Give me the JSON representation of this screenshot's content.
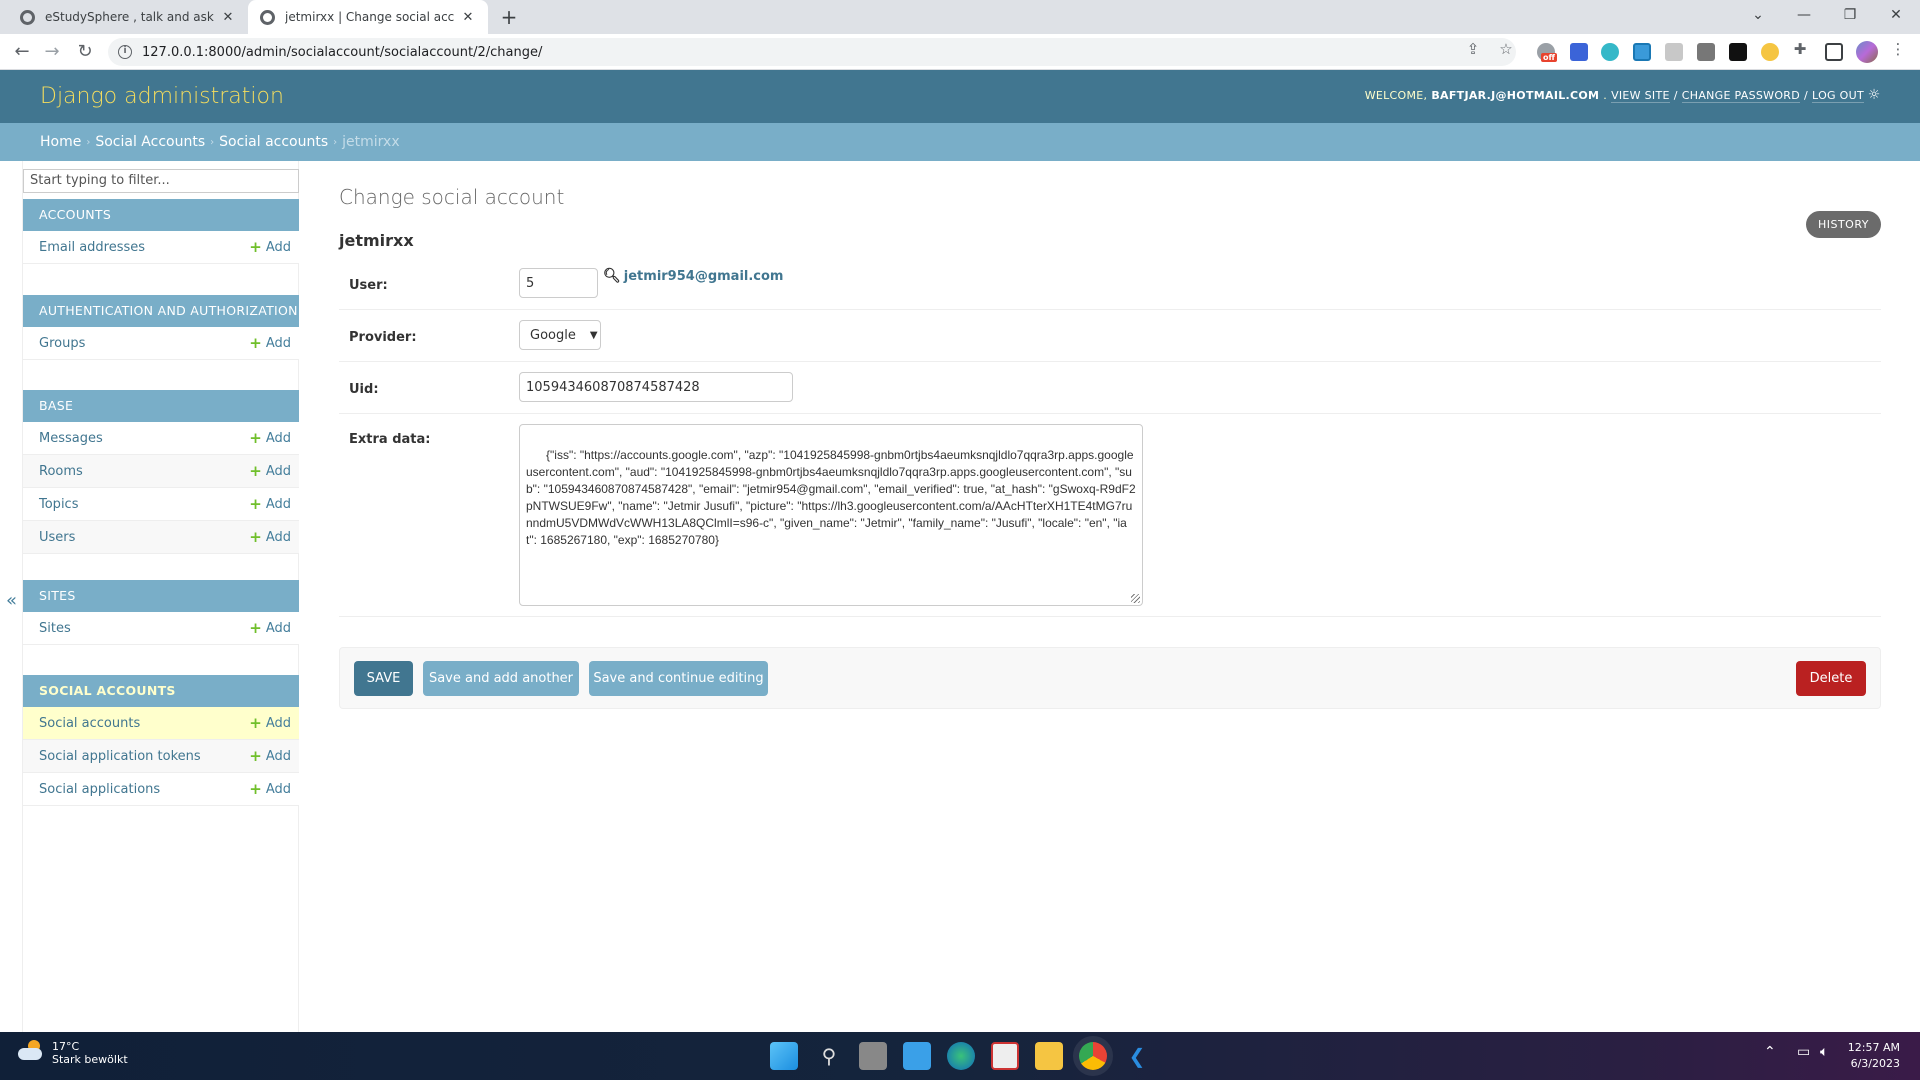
{
  "browser": {
    "tabs": [
      {
        "title": "eStudySphere , talk and ask abou",
        "active": false
      },
      {
        "title": "jetmirxx | Change social account |",
        "active": true
      }
    ],
    "url": "127.0.0.1:8000/admin/socialaccount/socialaccount/2/change/",
    "extension_badge": "off"
  },
  "header": {
    "brand": "Django administration",
    "welcome": "WELCOME,",
    "username": "BAFTJAR.J@HOTMAIL.COM",
    "view_site": "VIEW SITE",
    "change_password": "CHANGE PASSWORD",
    "log_out": "LOG OUT",
    "separator": "/"
  },
  "breadcrumbs": [
    {
      "label": "Home"
    },
    {
      "label": "Social Accounts"
    },
    {
      "label": "Social accounts"
    },
    {
      "label": "jetmirxx"
    }
  ],
  "sidebar": {
    "filter_placeholder": "Start typing to filter...",
    "add_label": "Add",
    "collapse_glyph": "«",
    "modules": [
      {
        "caption": "ACCOUNTS",
        "items": [
          "Email addresses"
        ]
      },
      {
        "caption": "AUTHENTICATION AND AUTHORIZATION",
        "items": [
          "Groups"
        ]
      },
      {
        "caption": "BASE",
        "items": [
          "Messages",
          "Rooms",
          "Topics",
          "Users"
        ]
      },
      {
        "caption": "SITES",
        "items": [
          "Sites"
        ]
      },
      {
        "caption": "SOCIAL ACCOUNTS",
        "items": [
          "Social accounts",
          "Social application tokens",
          "Social applications"
        ]
      }
    ]
  },
  "content": {
    "title": "Change social account",
    "object_name": "jetmirxx",
    "history_label": "HISTORY",
    "fields": {
      "user": {
        "label": "User:",
        "value": "5",
        "lookup_text": "jetmir954@gmail.com"
      },
      "provider": {
        "label": "Provider:",
        "value": "Google"
      },
      "uid": {
        "label": "Uid:",
        "value": "105943460870874587428"
      },
      "extra_data": {
        "label": "Extra data:",
        "value": "{\"iss\": \"https://accounts.google.com\", \"azp\": \"1041925845998-gnbm0rtjbs4aeumksnqjldlo7qqra3rp.apps.googleusercontent.com\", \"aud\": \"1041925845998-gnbm0rtjbs4aeumksnqjldlo7qqra3rp.apps.googleusercontent.com\", \"sub\": \"105943460870874587428\", \"email\": \"jetmir954@gmail.com\", \"email_verified\": true, \"at_hash\": \"gSwoxq-R9dF2pNTWSUE9Fw\", \"name\": \"Jetmir Jusufi\", \"picture\": \"https://lh3.googleusercontent.com/a/AAcHTterXH1TE4tMG7runndmU5VDMWdVcWWH13LA8QClmlI=s96-c\", \"given_name\": \"Jetmir\", \"family_name\": \"Jusufi\", \"locale\": \"en\", \"iat\": 1685267180, \"exp\": 1685270780}"
      }
    },
    "buttons": {
      "save": "SAVE",
      "save_add_another": "Save and add another",
      "save_continue": "Save and continue editing",
      "delete": "Delete"
    }
  },
  "taskbar": {
    "weather_temp": "17°C",
    "weather_desc": "Stark bewölkt",
    "time": "12:57 AM",
    "date": "6/3/2023"
  }
}
